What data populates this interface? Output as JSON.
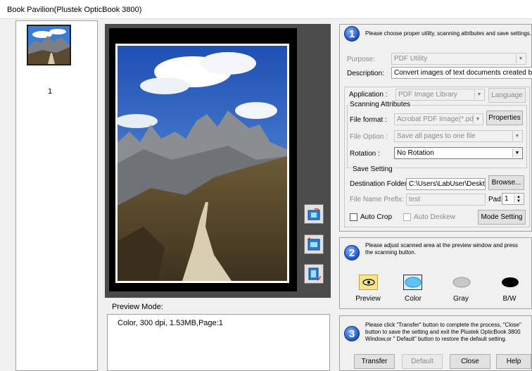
{
  "window": {
    "title": "Book Pavilion(Plustek OpticBook 3800)"
  },
  "thumbnails": [
    {
      "number": "1"
    }
  ],
  "preview": {
    "mode_label": "Preview Mode:",
    "info": "Color,  300 dpi,  1.53MB,Page:1"
  },
  "step1": {
    "number": "1",
    "instruction": "Please choose proper utility, scanning attributes and save settings.",
    "purpose_label": "Purpose:",
    "purpose_value": "PDF Utility",
    "description_label": "Description:",
    "description_value": "Convert images of text documents created by the",
    "application_label": "Application :",
    "application_value": "PDF Image Library",
    "language_button": "Language",
    "scanning_attributes_label": "Scanning Attributes",
    "file_format_label": "File format :",
    "file_format_value": "Acrobat PDF Image(*.pdf)",
    "properties_button": "Properties",
    "file_option_label": "File Option :",
    "file_option_value": "Save all pages to one file",
    "rotation_label": "Rotation :",
    "rotation_value": "No Rotation",
    "save_setting_label": "Save Setting",
    "destination_label": "Destination Folder:",
    "destination_value": "C:\\Users\\LabUser\\Desktop",
    "browse_button": "Browse...",
    "prefix_label": "File Name Prefix:",
    "prefix_value": "test",
    "pad_label": "Pad:",
    "pad_value": "1",
    "auto_crop_label": "Auto Crop",
    "auto_deskew_label": "Auto Deskew",
    "mode_setting_button": "Mode Setting"
  },
  "step2": {
    "number": "2",
    "instruction": "Please adjust scanned area at the preview window and press the scanning button.",
    "modes": [
      {
        "label": "Preview",
        "icon": "eye-icon"
      },
      {
        "label": "Color",
        "icon": "color-scan-icon"
      },
      {
        "label": "Gray",
        "icon": "gray-scan-icon"
      },
      {
        "label": "B/W",
        "icon": "bw-scan-icon"
      }
    ]
  },
  "step3": {
    "number": "3",
    "instruction": "Please click \"Transfer\" button to complete the process, \"Close\" button to save the setting and exit the Plustek OpticBook 3800 Window,or \" Default\" button to restore the default setting.",
    "transfer_button": "Transfer",
    "default_button": "Default",
    "close_button": "Close",
    "help_button": "Help"
  },
  "colors": {
    "badge_blue": "#1f4fc9",
    "preview_bg": "#4b4b4b",
    "color_mode": "#5fc3f5",
    "preview_mode": "#f6e58d"
  }
}
